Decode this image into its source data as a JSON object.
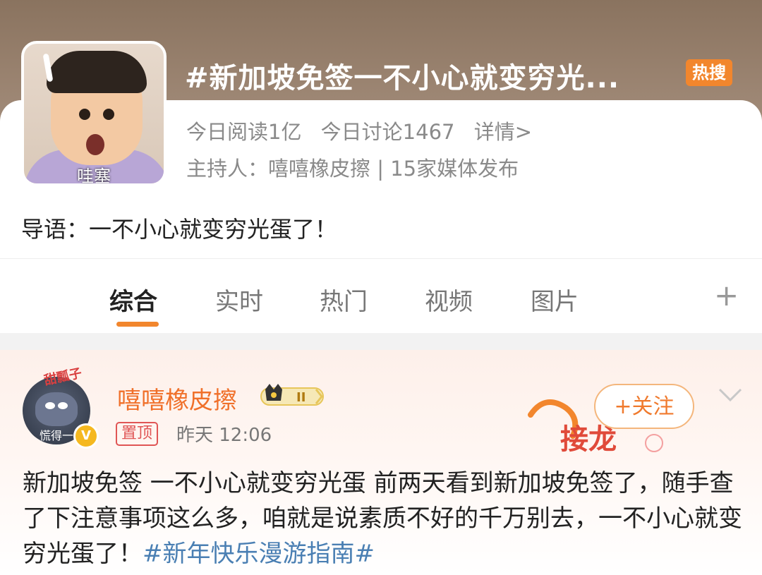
{
  "topic": {
    "title": "#新加坡免签一不小心就变穷光...",
    "hot_badge": "热搜",
    "stats": {
      "read": "今日阅读1亿",
      "discuss": "今日讨论1467",
      "detail": "详情>"
    },
    "host_line": "主持人：嘻嘻橡皮擦 | 15家媒体发布",
    "intro": "导语：一不小心就变穷光蛋了！",
    "avatar_caption": "哇塞"
  },
  "tabs": [
    {
      "label": "综合",
      "active": true
    },
    {
      "label": "实时"
    },
    {
      "label": "热门"
    },
    {
      "label": "视频"
    },
    {
      "label": "图片"
    }
  ],
  "tabs_more": "+",
  "post": {
    "username": "嘻嘻橡皮擦",
    "level_badge": "II",
    "avatar_text": "慌得一",
    "avatar_top_text": "甜瓢子",
    "pin_label": "置顶",
    "time": "昨天 12:06",
    "follow_label": "+关注",
    "deco_text": "接龙",
    "body_text": "新加坡免签 一不小心就变穷光蛋 前两天看到新加坡免签了，随手查了下注意事项这么多，咱就是说素质不好的千万别去，一不小心就变穷光蛋了！",
    "hashtag": "#新年快乐漫游指南#"
  },
  "colors": {
    "accent": "#f2862d",
    "username": "#f0702a",
    "hashtag": "#4a7fb3",
    "pin": "#e05555"
  }
}
